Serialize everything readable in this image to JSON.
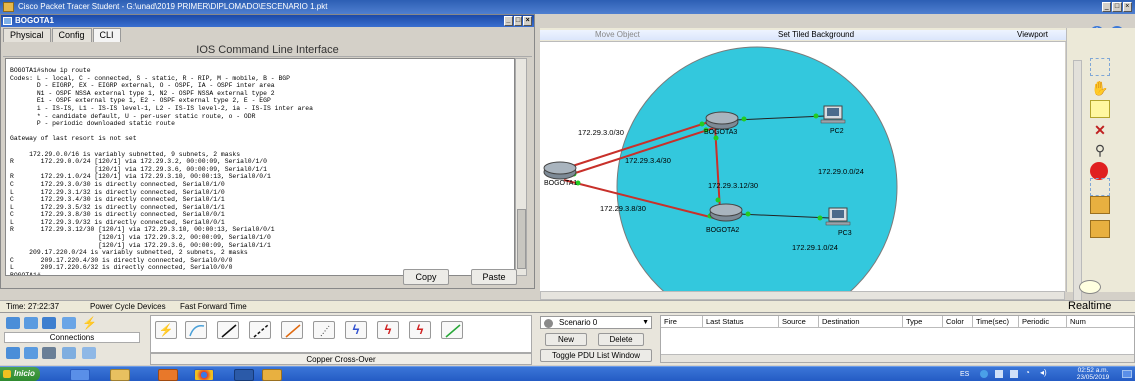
{
  "window": {
    "title": "Cisco Packet Tracer Student - G:\\unad\\2019 PRIMER\\DIPLOMADO\\ESCENARIO 1.pkt"
  },
  "device_window": {
    "title": "BOGOTA1",
    "tabs": [
      {
        "label": "Physical"
      },
      {
        "label": "Config"
      },
      {
        "label": "CLI"
      }
    ],
    "cli_header": "IOS Command Line Interface",
    "terminal_text": "BOGOTA1#show ip route\nCodes: L - local, C - connected, S - static, R - RIP, M - mobile, B - BGP\n       D - EIGRP, EX - EIGRP external, O - OSPF, IA - OSPF inter area\n       N1 - OSPF NSSA external type 1, N2 - OSPF NSSA external type 2\n       E1 - OSPF external type 1, E2 - OSPF external type 2, E - EGP\n       i - IS-IS, L1 - IS-IS level-1, L2 - IS-IS level-2, ia - IS-IS inter area\n       * - candidate default, U - per-user static route, o - ODR\n       P - periodic downloaded static route\n\nGateway of last resort is not set\n\n     172.29.0.0/16 is variably subnetted, 9 subnets, 2 masks\nR       172.29.0.0/24 [120/1] via 172.29.3.2, 00:00:09, Serial0/1/0\n                      [120/1] via 172.29.3.6, 00:00:09, Serial0/1/1\nR       172.29.1.0/24 [120/1] via 172.29.3.10, 00:00:13, Serial0/0/1\nC       172.29.3.0/30 is directly connected, Serial0/1/0\nL       172.29.3.1/32 is directly connected, Serial0/1/0\nC       172.29.3.4/30 is directly connected, Serial0/1/1\nL       172.29.3.5/32 is directly connected, Serial0/1/1\nC       172.29.3.8/30 is directly connected, Serial0/0/1\nL       172.29.3.9/32 is directly connected, Serial0/0/1\nR       172.29.3.12/30 [120/1] via 172.29.3.10, 00:00:13, Serial0/0/1\n                       [120/1] via 172.29.3.2, 00:00:09, Serial0/1/0\n                       [120/1] via 172.29.3.6, 00:00:09, Serial0/1/1\n     209.17.220.0/24 is variably subnetted, 2 subnets, 2 masks\nC       209.17.220.4/30 is directly connected, Serial0/0/0\nL       209.17.220.6/32 is directly connected, Serial0/0/0\nBOGOTA1#\nBOGOTA1#",
    "copy_label": "Copy",
    "paste_label": "Paste"
  },
  "workspace_toolbar": {
    "move_object": "Move Object",
    "set_tiled_background": "Set Tiled Background",
    "viewport": "Viewport"
  },
  "topology": {
    "nodes": [
      {
        "name": "BOGOTA1"
      },
      {
        "name": "BOGOTA3"
      },
      {
        "name": "BOGOTA2"
      },
      {
        "name": "PC2"
      },
      {
        "name": "PC3"
      }
    ],
    "networks": [
      "172.29.3.0/30",
      "172.29.3.4/30",
      "172.29.3.12/30",
      "172.29.3.8/30",
      "172.29.0.0/24",
      "172.29.1.0/24"
    ],
    "link_color": "#c8302a",
    "cloud_color": "#33c8dd"
  },
  "status_bar": {
    "time": "Time: 27:22:37",
    "power_cycle": "Power Cycle Devices",
    "fast_forward": "Fast Forward Time",
    "mode": "Realtime"
  },
  "bottom_panel": {
    "connections_label": "Connections",
    "selected_connection": "Copper Cross-Over",
    "scenario": "Scenario 0",
    "new_label": "New",
    "delete_label": "Delete",
    "toggle_pdu": "Toggle PDU List Window",
    "pdu_columns": [
      "Fire",
      "Last Status",
      "Source",
      "Destination",
      "Type",
      "Color",
      "Time(sec)",
      "Periodic",
      "Num"
    ]
  },
  "taskbar": {
    "start_label": "Inicio",
    "language": "ES",
    "clock_time": "02:52 a.m.",
    "clock_date": "23/05/2019"
  }
}
